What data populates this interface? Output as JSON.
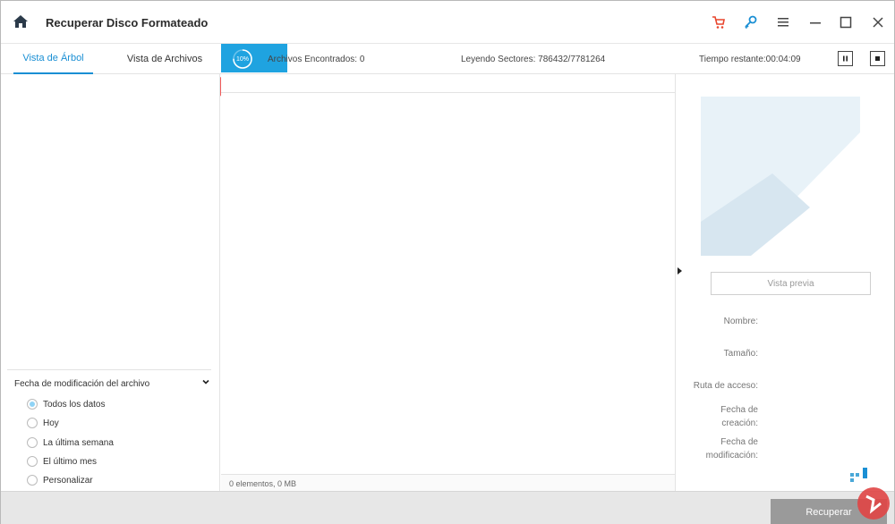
{
  "window": {
    "title": "Recuperar Disco Formateado"
  },
  "titlebar_icons": [
    "home-icon",
    "cart-icon",
    "key-icon",
    "menu-icon",
    "minimize-icon",
    "maximize-icon",
    "close-icon"
  ],
  "tabs": [
    {
      "label": "Vista de Árbol",
      "active": true
    },
    {
      "label": "Vista de Archivos",
      "active": false
    }
  ],
  "scan": {
    "progress_label": "10%",
    "progress_fraction": 0.1,
    "files_found": "Archivos Encontrados: 0",
    "sectors": "Leyendo Sectores: 786432/7781264",
    "time_remaining": "Tiempo restante:00:04:09",
    "pause_icon": "pause-icon",
    "stop_icon": "stop-icon"
  },
  "filter": {
    "title": "Fecha de modificación del archivo",
    "options": [
      {
        "label": "Todos los datos",
        "checked": true
      },
      {
        "label": "Hoy",
        "checked": false
      },
      {
        "label": "La última semana",
        "checked": false
      },
      {
        "label": "El último mes",
        "checked": false
      },
      {
        "label": "Personalizar",
        "checked": false
      }
    ]
  },
  "center": {
    "footer": "0 elementos, 0 MB"
  },
  "preview": {
    "button": "Vista previa",
    "labels": {
      "name": "Nombre:",
      "size": "Tamaño:",
      "path": "Ruta de acceso:",
      "created": "Fecha de creación:",
      "modified": "Fecha de modificación:"
    }
  },
  "bottom": {
    "recover": "Recuperar"
  },
  "colors": {
    "accent": "#1fa3e0",
    "arrow": "#f15a5a",
    "cart": "#e8462e",
    "key": "#1a8fd4"
  }
}
